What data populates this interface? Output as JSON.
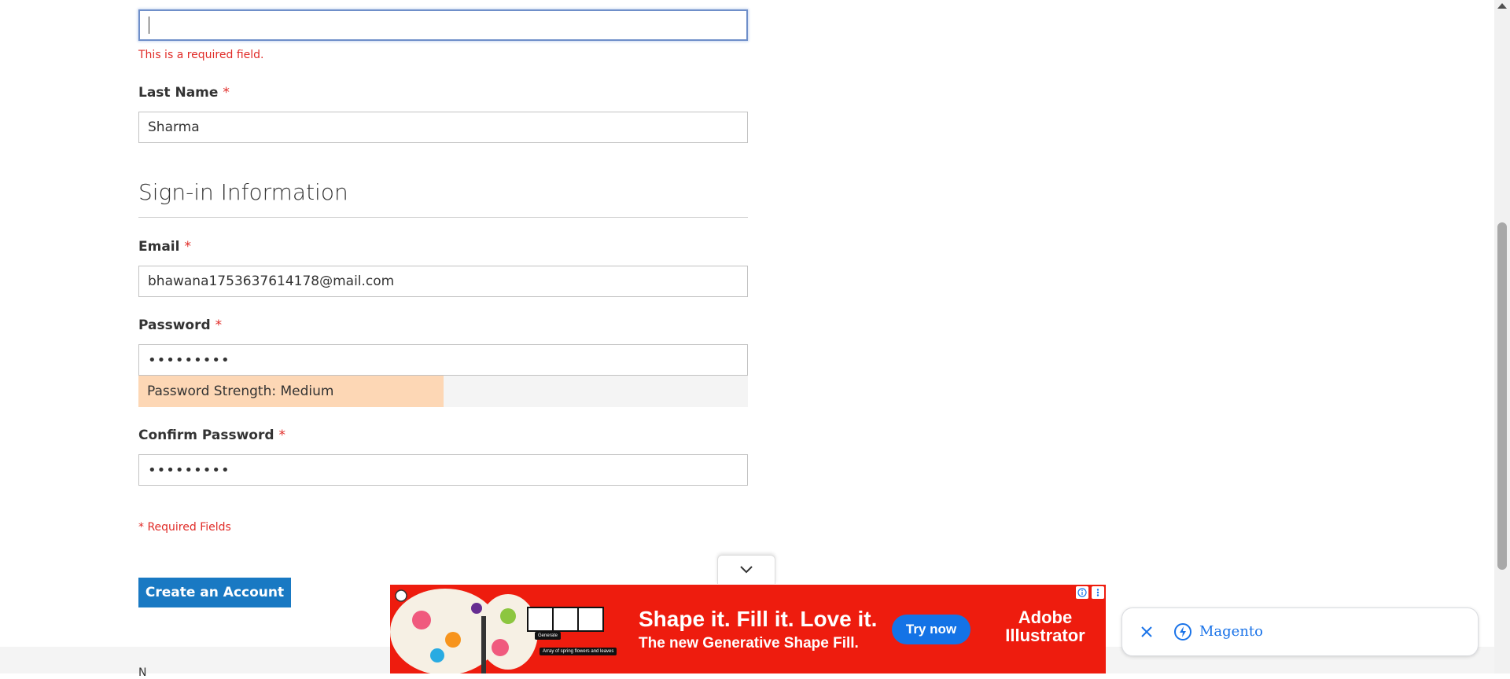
{
  "form": {
    "first_name_value": "",
    "first_name_error": "This is a required field.",
    "last_name_label": "Last Name",
    "last_name_value": "Sharma",
    "required_star": "*",
    "section_title": "Sign-in Information",
    "email_label": "Email",
    "email_value": "bhawana1753637614178@mail.com",
    "password_label": "Password",
    "password_value": "•••••••••",
    "password_strength_text": "Password Strength: Medium",
    "password_strength_fraction": 0.5,
    "confirm_password_label": "Confirm Password",
    "confirm_password_value": "•••••••••",
    "required_fields_note": "* Required Fields",
    "create_account_label": "Create an Account",
    "footer_partial": "N"
  },
  "ad": {
    "headline": "Shape it. Fill it. Love it.",
    "subline": "The new Generative Shape Fill.",
    "cta": "Try now",
    "brand_line1": "Adobe",
    "brand_line2": "Illustrator",
    "tag_generate": "Generate",
    "tag_prompt": "Array of spring flowers and leaves",
    "colors": {
      "background": "#ee1c0e",
      "cta": "#1473e6"
    }
  },
  "chip": {
    "label": "Magento"
  },
  "colors": {
    "accent": "#1979c3",
    "error": "#e02b27",
    "strength_medium": "#fdd7b5",
    "link_blue": "#1a73e8"
  },
  "icons": [
    "chevron-down-icon",
    "close-icon",
    "bolt-icon",
    "ad-info-icon",
    "ad-more-icon",
    "scroll-up-icon"
  ]
}
